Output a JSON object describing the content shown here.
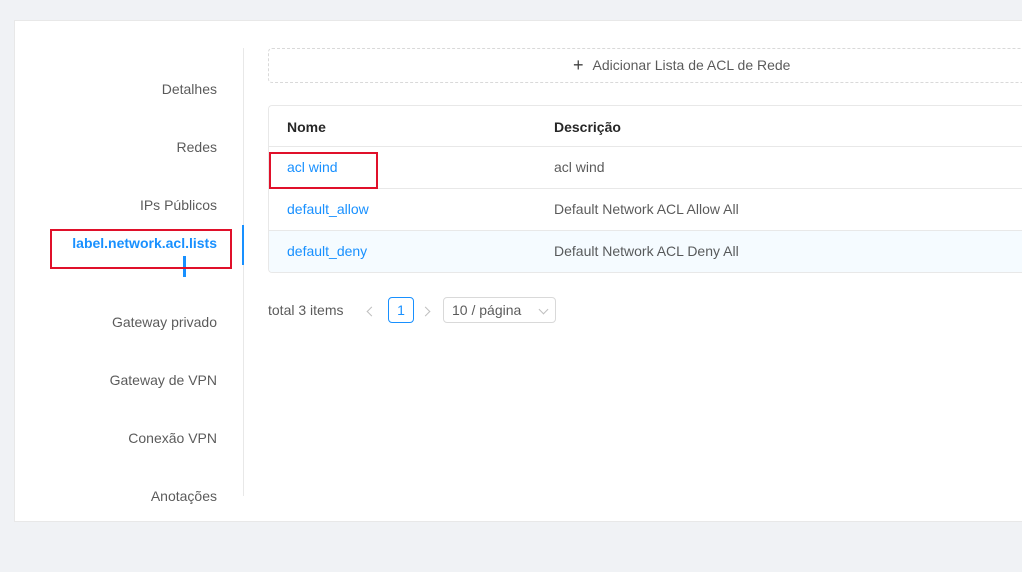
{
  "tabs": {
    "items": [
      {
        "label": "Detalhes"
      },
      {
        "label": "Redes"
      },
      {
        "label": "IPs Públicos"
      },
      {
        "label": "label.network.acl.lists",
        "active": true
      },
      {
        "label": "Gateway privado"
      },
      {
        "label": "Gateway de VPN"
      },
      {
        "label": "Conexão VPN"
      },
      {
        "label": "Anotações"
      }
    ]
  },
  "add_button": {
    "label": "Adicionar Lista de ACL de Rede",
    "icon": "plus-icon"
  },
  "table": {
    "columns": [
      "Nome",
      "Descrição"
    ],
    "rows": [
      {
        "name": "acl wind",
        "description": "acl wind"
      },
      {
        "name": "default_allow",
        "description": "Default Network ACL Allow All"
      },
      {
        "name": "default_deny",
        "description": "Default Network ACL Deny All"
      }
    ]
  },
  "pagination": {
    "total": "total 3 items",
    "current_page": "1",
    "page_size": "10 / página"
  },
  "colors": {
    "accent": "#1890ff",
    "highlight_box": "#e0102a",
    "background": "#f0f2f5"
  }
}
